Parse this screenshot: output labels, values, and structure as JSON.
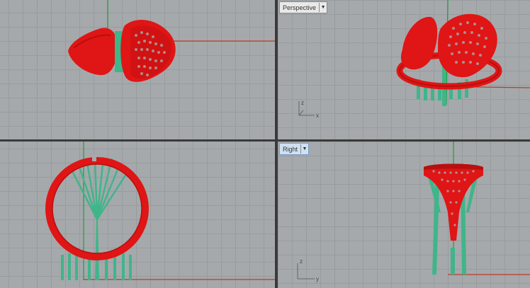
{
  "viewports": {
    "top": {
      "label": ""
    },
    "perspective": {
      "label": "Perspective",
      "dropdown_icon": "chevron-down-icon"
    },
    "front": {
      "label": ""
    },
    "right": {
      "label": "Right",
      "dropdown_icon": "chevron-down-icon"
    }
  },
  "axes": {
    "perspective": {
      "x": "x",
      "z": "z"
    },
    "right": {
      "z": "z",
      "y": "y"
    }
  },
  "colors": {
    "model_red": "#e01515",
    "supports_green": "#3fb58a",
    "grid_bg": "#a5a9ab",
    "grid_line": "#989c9e",
    "axis_red": "#c0392b",
    "axis_green": "#1f9d3a"
  }
}
